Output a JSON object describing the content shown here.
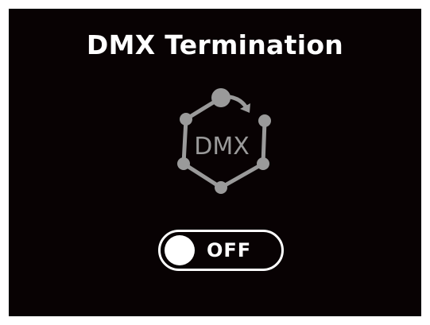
{
  "screen": {
    "title": "DMX Termination"
  },
  "icon": {
    "name": "dmx-network-icon",
    "text": "DMX",
    "color": "#9a9a9a"
  },
  "toggle": {
    "state": "off",
    "label": "OFF"
  },
  "colors": {
    "background": "#080203",
    "foreground": "#ffffff"
  }
}
